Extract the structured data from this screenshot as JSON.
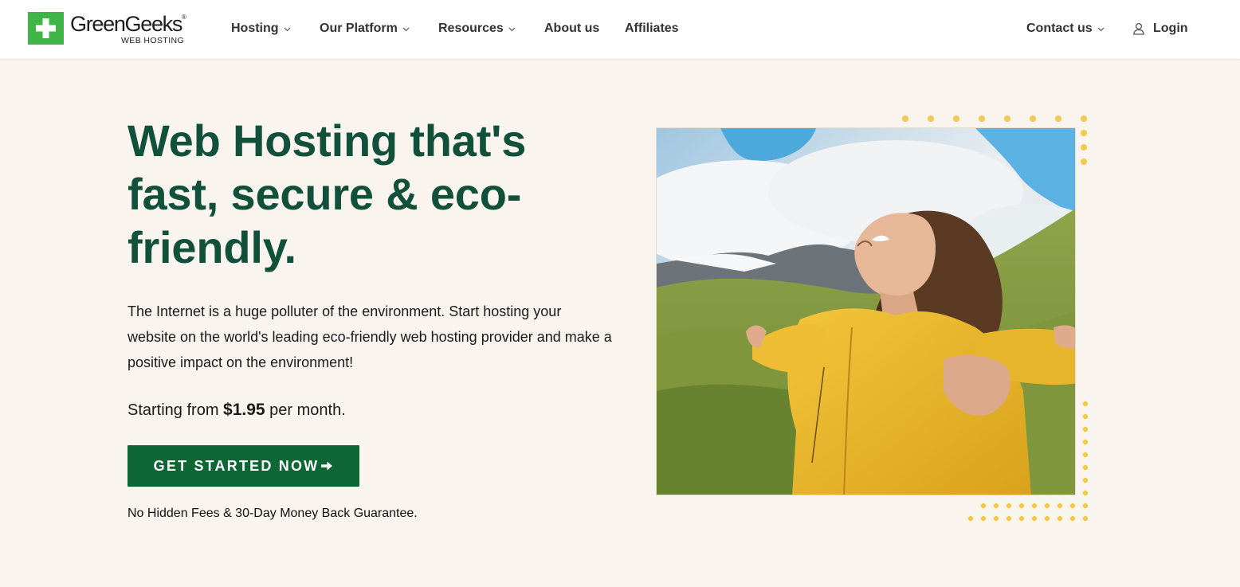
{
  "brand": {
    "name": "GreenGeeks",
    "registered": "®",
    "subtitle": "WEB HOSTING",
    "green": "#3fb548"
  },
  "nav": {
    "hosting": "Hosting",
    "platform": "Our Platform",
    "resources": "Resources",
    "about": "About us",
    "affiliates": "Affiliates",
    "contact": "Contact us",
    "login": "Login"
  },
  "hero": {
    "title": "Web Hosting that's fast, secure & eco-friendly.",
    "description": "The Internet is a huge polluter of the environment. Start hosting your website on the world's leading eco-friendly web hosting provider and make a positive impact on the environment!",
    "price_prefix": "Starting from",
    "price": "$1.95",
    "price_suffix": "per month.",
    "cta_label": "GET STARTED NOW",
    "guarantee": "No Hidden Fees & 30-Day Money Back Guarantee.",
    "title_color": "#11503a",
    "cta_color": "#0d6734",
    "dot_color": "#f2c94c"
  },
  "icons": {
    "chevron": "chevron-down-icon",
    "login": "user-icon",
    "arrow": "arrow-right-icon",
    "logo": "plus-icon"
  }
}
